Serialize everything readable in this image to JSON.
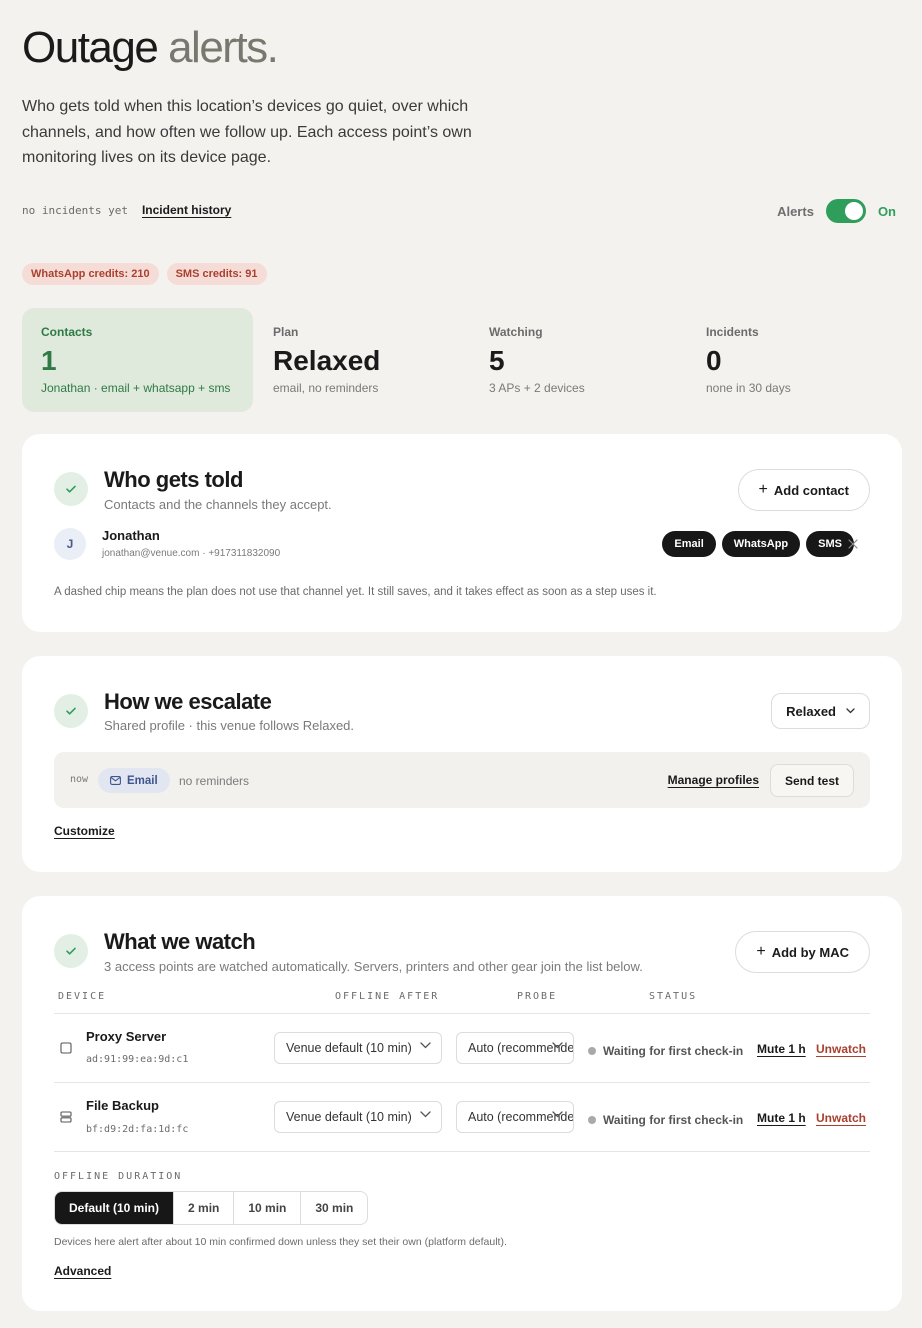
{
  "header": {
    "title_main": "Outage",
    "title_accent": "alerts.",
    "intro": "Who gets told when this location’s devices go quiet, over which channels, and how often we follow up. Each access point’s own monitoring lives on its device page.",
    "no_incidents": "no incidents yet",
    "incident_history": "Incident history",
    "alerts_label": "Alerts",
    "alerts_state": "On"
  },
  "credits": {
    "whatsapp": "WhatsApp credits: 210",
    "sms": "SMS credits: 91"
  },
  "stats": {
    "contacts": {
      "label": "Contacts",
      "value": "1",
      "sub": "Jonathan · email + whatsapp + sms"
    },
    "plan": {
      "label": "Plan",
      "value": "Relaxed",
      "sub": "email, no reminders"
    },
    "watching": {
      "label": "Watching",
      "value": "5",
      "sub": "3 APs + 2 devices"
    },
    "incidents": {
      "label": "Incidents",
      "value": "0",
      "sub": "none in 30 days"
    }
  },
  "who": {
    "title": "Who gets told",
    "subtitle": "Contacts and the channels they accept.",
    "add_button": "Add contact",
    "contact": {
      "initial": "J",
      "name": "Jonathan",
      "meta": "jonathan@venue.com · +917311832090",
      "channels": [
        "Email",
        "WhatsApp",
        "SMS"
      ]
    },
    "note": "A dashed chip means the plan does not use that channel yet. It still saves, and it takes effect as soon as a step uses it."
  },
  "escalate": {
    "title": "How we escalate",
    "subtitle": "Shared profile · this venue follows Relaxed.",
    "profile": "Relaxed",
    "step_time": "now",
    "step_channel": "Email",
    "step_note": "no reminders",
    "manage": "Manage profiles",
    "send_test": "Send test",
    "customize": "Customize"
  },
  "watch": {
    "title": "What we watch",
    "subtitle": "3 access points are watched automatically. Servers, printers and other gear join the list below.",
    "add_button": "Add by MAC",
    "columns": [
      "DEVICE",
      "OFFLINE AFTER",
      "PROBE",
      "STATUS"
    ],
    "devices": [
      {
        "name": "Proxy Server",
        "mac": "ad:91:99:ea:9d:c1",
        "offline": "Venue default (10 min)",
        "probe": "Auto (recommended)",
        "status": "Waiting for first check-in",
        "mute": "Mute 1 h",
        "unwatch": "Unwatch"
      },
      {
        "name": "File Backup",
        "mac": "bf:d9:2d:fa:1d:fc",
        "offline": "Venue default (10 min)",
        "probe": "Auto (recommended)",
        "status": "Waiting for first check-in",
        "mute": "Mute 1 h",
        "unwatch": "Unwatch"
      }
    ],
    "offline_duration_label": "OFFLINE DURATION",
    "durations": [
      "Default (10 min)",
      "2 min",
      "10 min",
      "30 min"
    ],
    "duration_note": "Devices here alert after about 10 min confirmed down unless they set their own (platform default).",
    "advanced": "Advanced"
  }
}
